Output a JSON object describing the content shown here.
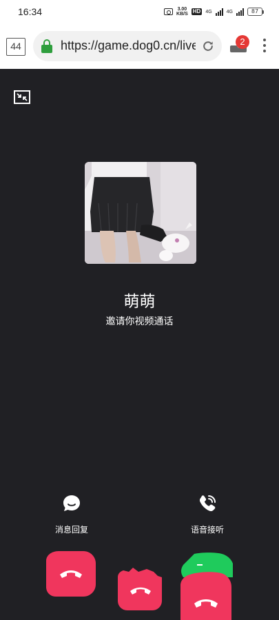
{
  "status_bar": {
    "time": "16:34",
    "net_speed_value": "3.00",
    "net_speed_unit": "KB/S",
    "hd": "HD",
    "sig1": "4G",
    "sig2": "4G",
    "battery": "87"
  },
  "browser": {
    "tab_count": "44",
    "url": "https://game.dog0.cn/live",
    "download_badge": "2"
  },
  "call": {
    "caller_name": "萌萌",
    "caller_subtitle": "邀请你视频通话",
    "message_reply_label": "消息回复",
    "voice_answer_label": "语音接听"
  },
  "colors": {
    "call_background": "#202024",
    "decline": "#f0365d",
    "accept": "#1fcb5c",
    "lock": "#2e9e3d",
    "badge": "#e53935"
  },
  "icons": {
    "shrink": "shrink-window-icon",
    "message": "chat-bubble-icon",
    "voice": "phone-ringing-icon",
    "decline": "phone-hangup-icon"
  }
}
